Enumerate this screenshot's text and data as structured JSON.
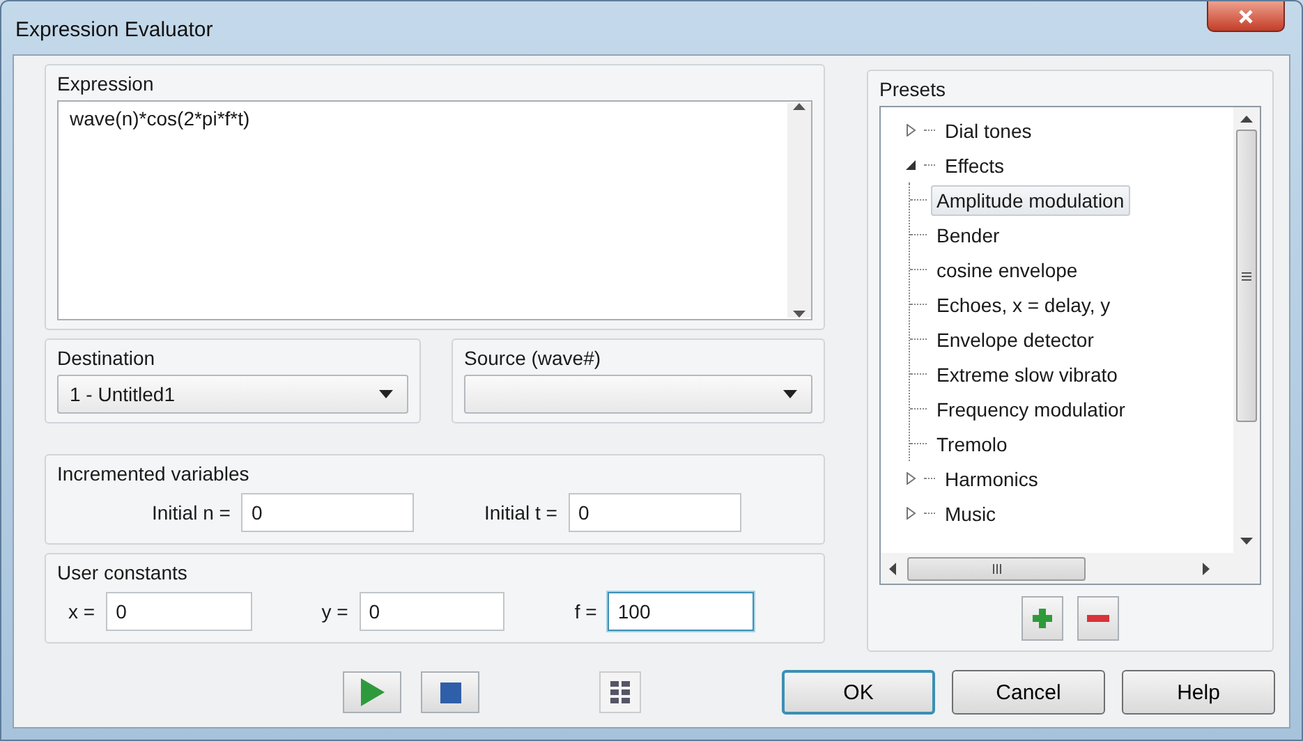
{
  "window": {
    "title": "Expression Evaluator"
  },
  "expression": {
    "label": "Expression",
    "value": "wave(n)*cos(2*pi*f*t)"
  },
  "destination": {
    "label": "Destination",
    "value": "1 - Untitled1"
  },
  "source": {
    "label": "Source (wave#)"
  },
  "incremented_variables": {
    "label": "Incremented variables",
    "fields": [
      {
        "label": "Initial n =",
        "value": "0",
        "focused": false
      },
      {
        "label": "Initial t =",
        "value": "0",
        "focused": false
      }
    ]
  },
  "user_constants": {
    "label": "User constants",
    "fields": [
      {
        "label": "x =",
        "value": "0",
        "focused": false
      },
      {
        "label": "y =",
        "value": "0",
        "focused": false
      },
      {
        "label": "f =",
        "value": "100",
        "focused": true
      }
    ]
  },
  "presets": {
    "label": "Presets",
    "items": [
      {
        "label": "Dial tones",
        "expanded": false,
        "selected": false
      },
      {
        "label": "Effects",
        "expanded": true,
        "selected": false,
        "children": [
          {
            "label": "Amplitude modulation",
            "selected": true
          },
          {
            "label": "Bender",
            "selected": false
          },
          {
            "label": "cosine envelope",
            "selected": false
          },
          {
            "label": "Echoes, x = delay, y",
            "selected": false
          },
          {
            "label": "Envelope detector",
            "selected": false
          },
          {
            "label": "Extreme slow vibrato",
            "selected": false
          },
          {
            "label": "Frequency modulatior",
            "selected": false
          },
          {
            "label": "Tremolo",
            "selected": false
          }
        ]
      },
      {
        "label": "Harmonics",
        "expanded": false,
        "selected": false
      },
      {
        "label": "Music",
        "expanded": false,
        "selected": false
      }
    ]
  },
  "buttons": [
    {
      "label": "OK",
      "default": true
    },
    {
      "label": "Cancel",
      "default": false
    },
    {
      "label": "Help",
      "default": false
    }
  ]
}
